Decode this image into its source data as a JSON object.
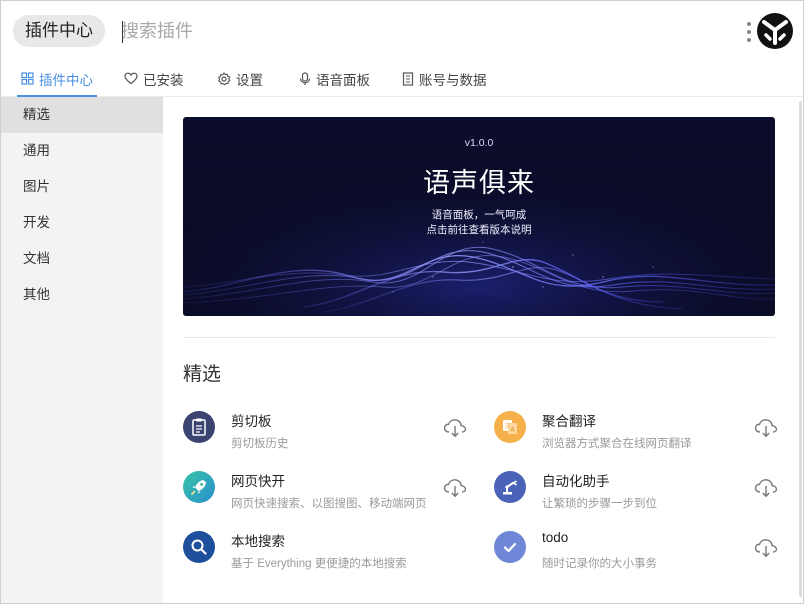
{
  "header": {
    "title": "插件中心",
    "search_placeholder": "搜索插件",
    "more_icon": "more-vertical-icon",
    "logo_icon": "app-logo-icon"
  },
  "tabs": [
    {
      "label": "插件中心",
      "icon": "grid-icon",
      "active": true
    },
    {
      "label": "已安装",
      "icon": "heart-icon",
      "active": false
    },
    {
      "label": "设置",
      "icon": "gear-icon",
      "active": false
    },
    {
      "label": "语音面板",
      "icon": "microphone-icon",
      "active": false
    },
    {
      "label": "账号与数据",
      "icon": "document-icon",
      "active": false
    }
  ],
  "sidebar": {
    "items": [
      {
        "label": "精选",
        "active": true
      },
      {
        "label": "通用",
        "active": false
      },
      {
        "label": "图片",
        "active": false
      },
      {
        "label": "开发",
        "active": false
      },
      {
        "label": "文档",
        "active": false
      },
      {
        "label": "其他",
        "active": false
      }
    ]
  },
  "banner": {
    "version": "v1.0.0",
    "title": "语声俱来",
    "line1": "语音面板，一气呵成",
    "line2": "点击前往查看版本说明"
  },
  "section": {
    "title": "精选"
  },
  "plugins": [
    {
      "name": "剪切板",
      "desc": "剪切板历史",
      "icon": "clipboard-icon",
      "color": "#3b4470"
    },
    {
      "name": "聚合翻译",
      "desc": "浏览器方式聚合在线网页翻译",
      "icon": "translate-icon",
      "color": "#f5b04a"
    },
    {
      "name": "网页快开",
      "desc": "网页快速搜索、以图搜图、移动端网页",
      "icon": "rocket-icon",
      "color": "#2bb39a"
    },
    {
      "name": "自动化助手",
      "desc": "让繁琐的步骤一步到位",
      "icon": "robot-arm-icon",
      "color": "#4a63b8"
    },
    {
      "name": "本地搜索",
      "desc": "基于 Everything 更便捷的本地搜索",
      "icon": "search-icon",
      "color": "#1d4f9c"
    },
    {
      "name": "todo",
      "desc": "随时记录你的大小事务",
      "icon": "check-icon",
      "color": "#6f87d6"
    }
  ],
  "download_icon": "cloud-download-icon"
}
